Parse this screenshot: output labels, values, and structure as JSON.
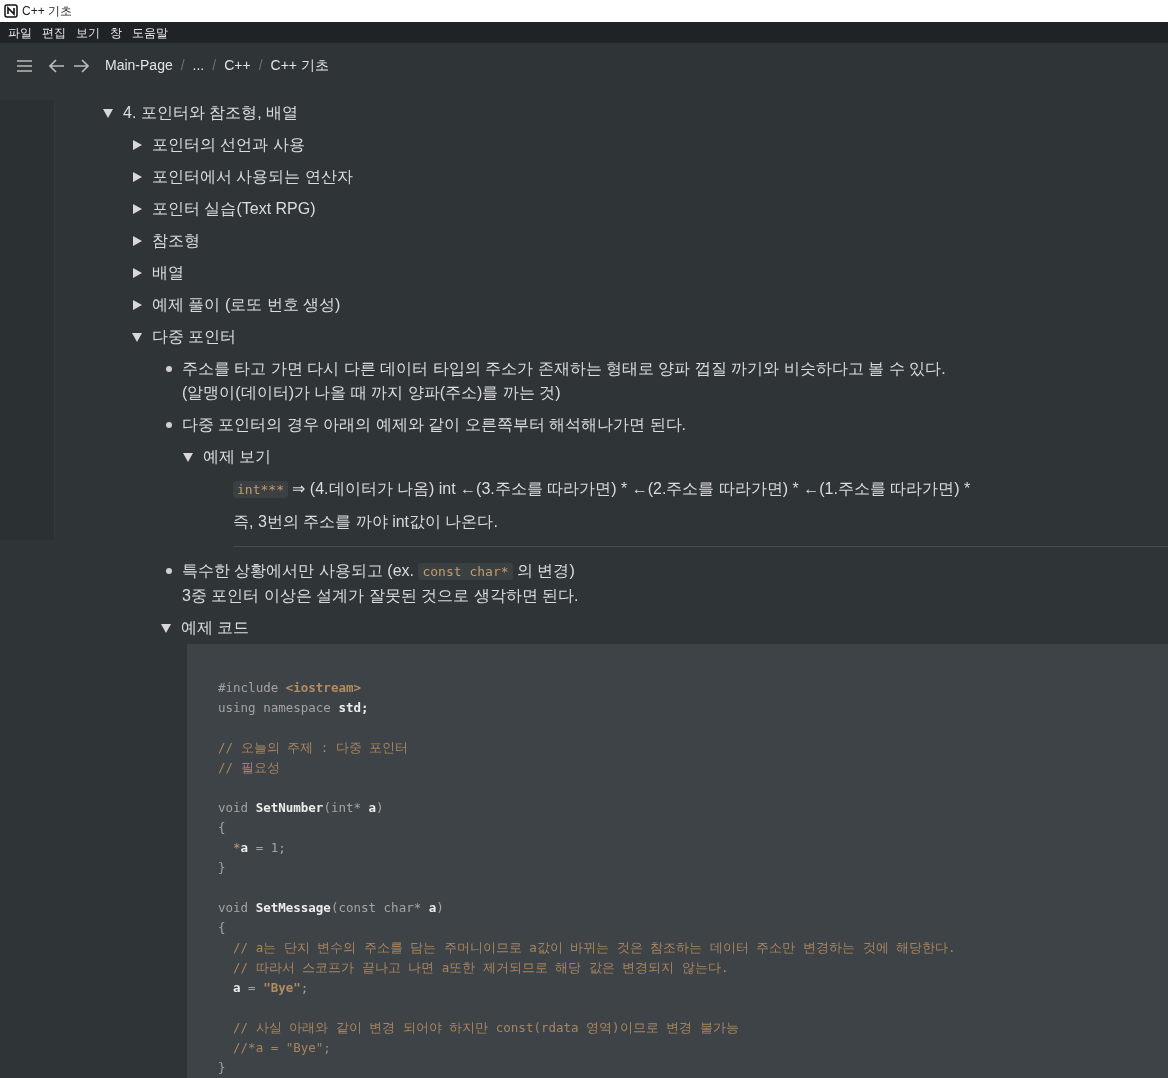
{
  "window": {
    "title": "C++ 기초"
  },
  "menu": [
    "파일",
    "편집",
    "보기",
    "창",
    "도움말"
  ],
  "breadcrumbs": [
    {
      "kind": "link",
      "text": "Main-Page"
    },
    {
      "kind": "sep",
      "text": "/"
    },
    {
      "kind": "link",
      "text": "..."
    },
    {
      "kind": "sep",
      "text": "/"
    },
    {
      "kind": "link",
      "text": "C++"
    },
    {
      "kind": "sep",
      "text": "/"
    },
    {
      "kind": "link",
      "text": "C++ 기초"
    }
  ],
  "blocks": [
    {
      "kind": "toggle",
      "title": "4. 포인터와 참조형, 배열",
      "expanded": true,
      "children": [
        {
          "kind": "toggle",
          "title": "포인터의 선언과 사용",
          "expanded": false
        },
        {
          "kind": "toggle",
          "title": "포인터에서 사용되는 연산자",
          "expanded": false
        },
        {
          "kind": "toggle",
          "title": "포인터 실습(Text RPG)",
          "expanded": false
        },
        {
          "kind": "toggle",
          "title": "참조형",
          "expanded": false
        },
        {
          "kind": "toggle",
          "title": "배열",
          "expanded": false
        },
        {
          "kind": "toggle",
          "title": "예제 풀이 (로또 번호 생성)",
          "expanded": false
        },
        {
          "kind": "toggle",
          "title": "다중 포인터",
          "expanded": true,
          "children": [
            {
              "kind": "bullet",
              "lines": [
                [
                  {
                    "kind": "text",
                    "text": "주소를 타고 가면 다시 다른 데이터 타입의 주소가 존재하는 형태로 양파 껍질 까기와 비슷하다고 볼 수 있다."
                  }
                ],
                [
                  {
                    "kind": "text",
                    "text": "(알맹이(데이터)가 나올 때 까지 양파(주소)를 까는 것)"
                  }
                ]
              ]
            },
            {
              "kind": "bullet",
              "lines": [
                [
                  {
                    "kind": "text",
                    "text": "다중 포인터의 경우 아래의 예제와 같이 오른쪽부터 해석해나가면 된다."
                  }
                ]
              ],
              "children": [
                {
                  "kind": "toggle",
                  "title": "예제 보기",
                  "expanded": true,
                  "children": [
                    {
                      "kind": "paragraph",
                      "parts": [
                        {
                          "kind": "code",
                          "text": "int***"
                        },
                        {
                          "kind": "text",
                          "text": " ⇒ (4.데이터가 나옴) int ←(3.주소를 따라가면) * ←(2.주소를 따라가면) * ←(1.주소를 따라가면) *"
                        }
                      ]
                    },
                    {
                      "kind": "paragraph",
                      "parts": [
                        {
                          "kind": "text",
                          "text": "즉, 3번의 주소를 까야 int값이 나온다."
                        }
                      ]
                    },
                    {
                      "kind": "divider"
                    }
                  ]
                }
              ]
            },
            {
              "kind": "bullet",
              "lines": [
                [
                  {
                    "kind": "text",
                    "text": "특수한 상황에서만 사용되고 (ex. "
                  },
                  {
                    "kind": "code",
                    "text": "const char*"
                  },
                  {
                    "kind": "text",
                    "text": " 의 변경)"
                  }
                ],
                [
                  {
                    "kind": "text",
                    "text": "3중 포인터 이상은 설계가 잘못된 것으로 생각하면 된다."
                  }
                ]
              ]
            },
            {
              "kind": "toggle",
              "title": "예제 코드",
              "expanded": true,
              "children": [
                {
                  "kind": "code",
                  "lines": [
                    {
                      "kind": "line",
                      "tokens": [
                        {
                          "kind": "kw",
                          "text": "#include "
                        },
                        {
                          "kind": "str",
                          "text": "<iostream>"
                        }
                      ]
                    },
                    {
                      "kind": "line",
                      "tokens": [
                        {
                          "kind": "kw",
                          "text": "using namespace "
                        },
                        {
                          "kind": "plain",
                          "text": "std;"
                        }
                      ]
                    },
                    {
                      "kind": "blank"
                    },
                    {
                      "kind": "line",
                      "tokens": [
                        {
                          "kind": "comment",
                          "text": "// 오늘의 주제 : 다중 포인터"
                        }
                      ]
                    },
                    {
                      "kind": "line",
                      "tokens": [
                        {
                          "kind": "comment",
                          "text": "// 필요성"
                        }
                      ]
                    },
                    {
                      "kind": "blank"
                    },
                    {
                      "kind": "line",
                      "tokens": [
                        {
                          "kind": "kw",
                          "text": "void "
                        },
                        {
                          "kind": "plain",
                          "text": "SetNumber"
                        },
                        {
                          "kind": "punct",
                          "text": "(int* "
                        },
                        {
                          "kind": "plain",
                          "text": "a"
                        },
                        {
                          "kind": "punct",
                          "text": ")"
                        }
                      ]
                    },
                    {
                      "kind": "line",
                      "tokens": [
                        {
                          "kind": "punct",
                          "text": "{"
                        }
                      ]
                    },
                    {
                      "kind": "line",
                      "tokens": [
                        {
                          "kind": "op",
                          "text": "  *"
                        },
                        {
                          "kind": "plain",
                          "text": "a"
                        },
                        {
                          "kind": "punct",
                          "text": " = 1;"
                        }
                      ]
                    },
                    {
                      "kind": "line",
                      "tokens": [
                        {
                          "kind": "punct",
                          "text": "}"
                        }
                      ]
                    },
                    {
                      "kind": "blank"
                    },
                    {
                      "kind": "line",
                      "tokens": [
                        {
                          "kind": "kw",
                          "text": "void "
                        },
                        {
                          "kind": "plain",
                          "text": "SetMessage"
                        },
                        {
                          "kind": "punct",
                          "text": "(const char* "
                        },
                        {
                          "kind": "plain",
                          "text": "a"
                        },
                        {
                          "kind": "punct",
                          "text": ")"
                        }
                      ]
                    },
                    {
                      "kind": "line",
                      "tokens": [
                        {
                          "kind": "punct",
                          "text": "{"
                        }
                      ]
                    },
                    {
                      "kind": "line",
                      "tokens": [
                        {
                          "kind": "comment",
                          "text": "  // a는 단지 변수의 주소를 담는 주머니이므로 a값이 바뀌는 것은 참조하는 데이터 주소만 변경하는 것에 해당한다."
                        }
                      ]
                    },
                    {
                      "kind": "line",
                      "tokens": [
                        {
                          "kind": "comment",
                          "text": "  // 따라서 스코프가 끝나고 나면 a또한 제거되므로 해당 값은 변경되지 않는다."
                        }
                      ]
                    },
                    {
                      "kind": "line",
                      "tokens": [
                        {
                          "kind": "plain",
                          "text": "  a"
                        },
                        {
                          "kind": "punct",
                          "text": " = "
                        },
                        {
                          "kind": "str",
                          "text": "\"Bye\""
                        },
                        {
                          "kind": "punct",
                          "text": ";"
                        }
                      ]
                    },
                    {
                      "kind": "blank"
                    },
                    {
                      "kind": "line",
                      "tokens": [
                        {
                          "kind": "comment",
                          "text": "  // 사실 아래와 같이 변경 되어야 하지만 const(rdata 영역)이므로 변경 불가능"
                        }
                      ]
                    },
                    {
                      "kind": "line",
                      "tokens": [
                        {
                          "kind": "comment",
                          "text": "  //*a = \"Bye\";"
                        }
                      ]
                    },
                    {
                      "kind": "line",
                      "tokens": [
                        {
                          "kind": "punct",
                          "text": "}"
                        }
                      ]
                    }
                  ]
                }
              ]
            }
          ]
        }
      ]
    }
  ]
}
